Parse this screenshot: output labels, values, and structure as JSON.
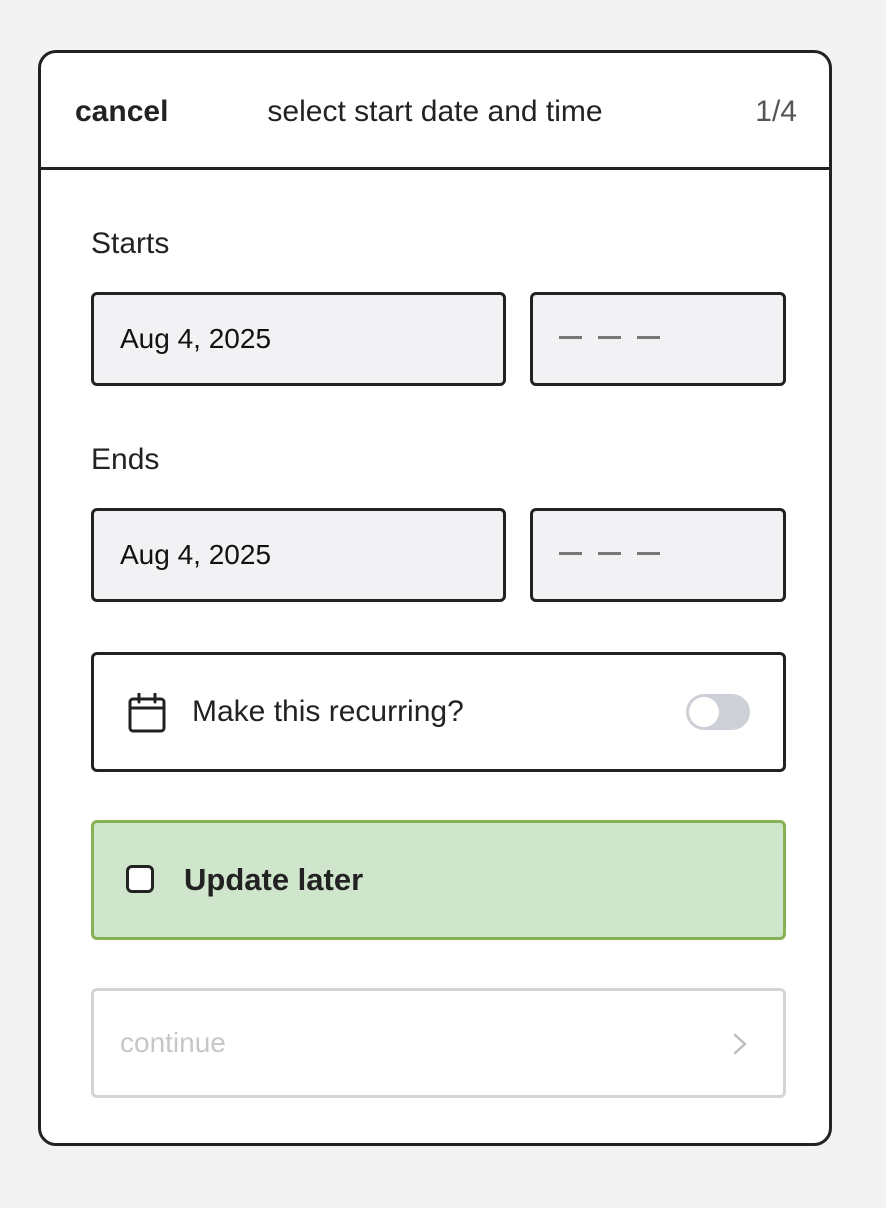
{
  "header": {
    "cancel_label": "cancel",
    "title": "select start date and time",
    "step": "1/4"
  },
  "starts": {
    "label": "Starts",
    "date": "Aug 4, 2025",
    "time_placeholder": "– – –"
  },
  "ends": {
    "label": "Ends",
    "date": "Aug 4, 2025",
    "time_placeholder": "– – –"
  },
  "recurring": {
    "icon": "calendar-icon",
    "label": "Make this recurring?",
    "enabled": false
  },
  "update_later": {
    "label": "Update later",
    "checked": false,
    "accent": "#86b255",
    "background": "#cfe5cc"
  },
  "continue": {
    "label": "continue",
    "icon": "chevron-right-icon",
    "disabled": true
  }
}
